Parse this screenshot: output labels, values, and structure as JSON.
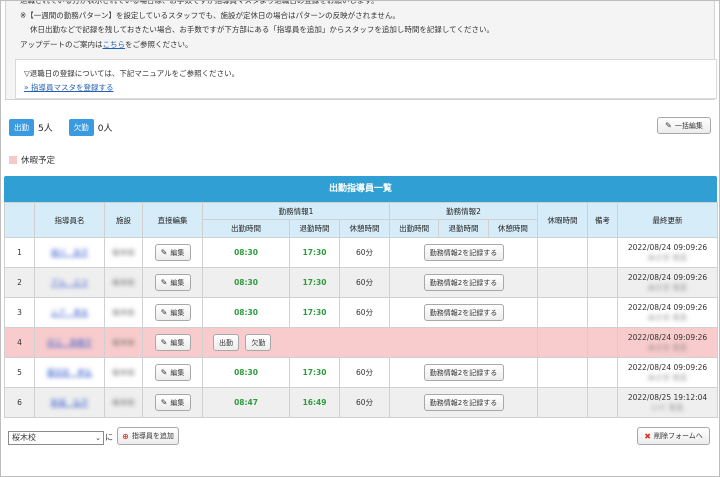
{
  "notice": {
    "line0": "退職されている方が表示されている場合は、お手数ですが指導員マスタより退職日の登録をお願いします。",
    "line1": "※【一週間の勤務パターン】を設定しているスタッフでも、施設が定休日の場合はパターンの反映がされません。",
    "line2": "休日出勤などで記録を残しておきたい場合、お手数ですが下方部にある「指導員を追加」からスタッフを追加し時間を記録してください。",
    "line3_prefix": "アップデートのご案内は",
    "line3_link": "こちら",
    "line3_suffix": "をご参照ください。"
  },
  "manual": {
    "text": "▽退職日の登録については、下記マニュアルをご参照ください。",
    "link": "» 指導員マスタを登録する"
  },
  "counts": {
    "present_label": "出勤",
    "present_value": "5人",
    "absent_label": "欠勤",
    "absent_value": "0人"
  },
  "bulk_edit_label": "一括編集",
  "legend_label": "休暇予定",
  "table": {
    "title": "出勤指導員一覧",
    "headers": {
      "name": "指導員名",
      "facility": "施設",
      "direct_edit": "直接編集",
      "work1": "勤務情報1",
      "work2": "勤務情報2",
      "clock_in": "出勤時間",
      "clock_out": "退勤時間",
      "break": "休憩時間",
      "leave_time": "休暇時間",
      "notes": "備考",
      "updated": "最終更新"
    },
    "edit_label": "編集",
    "record_label": "勤務情報2を記録する",
    "present_btn": "出勤",
    "absent_btn": "欠勤",
    "rows": [
      {
        "no": "1",
        "name": "堀川　良子",
        "facility": "桜木校",
        "in": "08:30",
        "out": "17:30",
        "brk": "60分",
        "updated": "2022/08/24 09:09:26",
        "by": "みさき 先生"
      },
      {
        "no": "2",
        "name": "アル　エマ",
        "facility": "桜木校",
        "in": "08:30",
        "out": "17:30",
        "brk": "60分",
        "updated": "2022/08/24 09:09:26",
        "by": "みさき 先生"
      },
      {
        "no": "3",
        "name": "ムア　孝夫",
        "facility": "桜木校",
        "in": "08:30",
        "out": "17:30",
        "brk": "60分",
        "updated": "2022/08/24 09:09:26",
        "by": "みさき 先生"
      },
      {
        "no": "4",
        "name": "近江　美穂子",
        "facility": "桜木校",
        "in": "",
        "out": "",
        "brk": "",
        "updated": "2022/08/24 09:09:26",
        "by": "みさき 先生"
      },
      {
        "no": "5",
        "name": "藤田宮　孝弘",
        "facility": "桜木校",
        "in": "08:30",
        "out": "17:30",
        "brk": "60分",
        "updated": "2022/08/24 09:09:26",
        "by": "みさき 先生"
      },
      {
        "no": "6",
        "name": "新城　弘子",
        "facility": "桜木校",
        "in": "08:47",
        "out": "16:49",
        "brk": "60分",
        "updated": "2022/08/25 19:12:04",
        "by": "いぐ 先生"
      }
    ]
  },
  "footer": {
    "school_select": "桜木校",
    "ni": "に",
    "add_label": "指導員を追加",
    "delete_label": "削除フォームへ"
  },
  "colors": {
    "header_blue": "#2f9fd4",
    "leave_pink": "#f8cccc",
    "time_green": "#2e9a3e"
  }
}
